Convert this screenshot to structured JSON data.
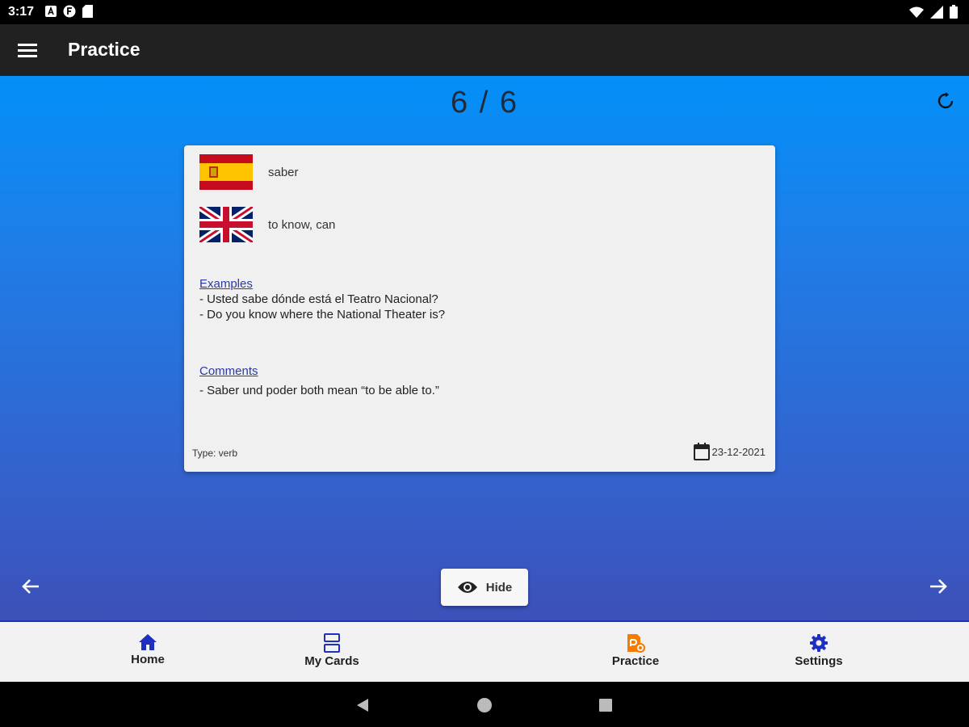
{
  "status_bar": {
    "time": "3:17",
    "left_icons": [
      "notification-a-icon",
      "notification-f-icon",
      "sd-card-icon"
    ],
    "right_icons": [
      "wifi-icon",
      "signal-icon",
      "battery-icon"
    ]
  },
  "app_bar": {
    "title": "Practice",
    "menu_icon": "hamburger-menu-icon"
  },
  "practice": {
    "counter": "6 / 6",
    "refresh_icon": "refresh-icon"
  },
  "card": {
    "source_flag": "spain-flag-icon",
    "source_word": "saber",
    "target_flag": "uk-flag-icon",
    "target_word": "to know, can",
    "examples_title": "Examples",
    "examples": [
      "- Usted sabe dónde está el Teatro Nacional?",
      "- Do you know where the National Theater is?"
    ],
    "comments_title": "Comments",
    "comments": [
      "- Saber und poder both mean “to be able to.”"
    ],
    "type_label": "Type: verb",
    "date": "23-12-2021"
  },
  "controls": {
    "hide_label": "Hide",
    "hide_icon": "eye-icon",
    "prev_icon": "arrow-left-icon",
    "next_icon": "arrow-right-icon"
  },
  "bottom_nav": {
    "items": [
      {
        "label": "Home",
        "icon": "home-icon"
      },
      {
        "label": "My Cards",
        "icon": "cards-icon"
      },
      {
        "label": "Practice",
        "icon": "practice-icon"
      },
      {
        "label": "Settings",
        "icon": "gear-icon"
      }
    ],
    "active": "Practice"
  },
  "colors": {
    "accent_blue": "#1f2fc0",
    "practice_orange": "#f57c00",
    "gradient_top": "#0390f8",
    "gradient_bottom": "#3d50b8"
  }
}
